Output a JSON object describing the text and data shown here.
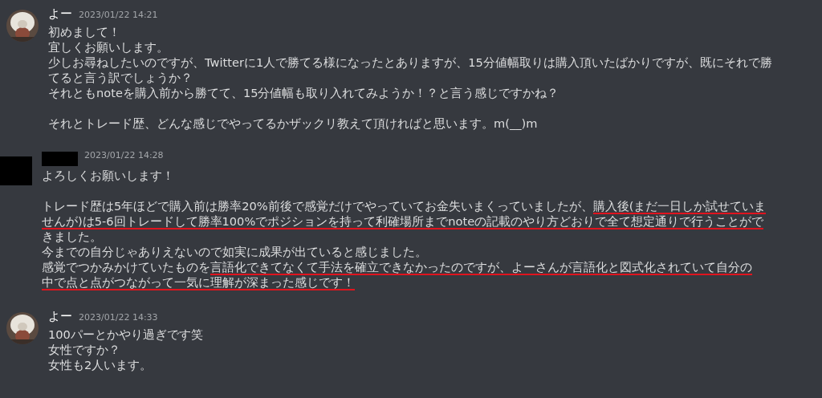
{
  "messages": [
    {
      "redacted": false,
      "author": "よー",
      "timestamp": "2023/01/22 14:21",
      "paragraphs": [
        {
          "lines": [
            [
              {
                "text": "初めまして！",
                "underlined": false
              }
            ],
            [
              {
                "text": "宜しくお願いします。",
                "underlined": false
              }
            ],
            [
              {
                "text": "少しお尋ねしたいのですが、Twitterに1人で勝てる様になったとありますが、15分値幅取りは購入頂いたばかりですが、既にそれで勝",
                "underlined": false
              }
            ],
            [
              {
                "text": "てると言う訳でしょうか？",
                "underlined": false
              }
            ],
            [
              {
                "text": "それともnoteを購入前から勝てて、15分値幅も取り入れてみようか！？と言う感じですかね？",
                "underlined": false
              }
            ]
          ]
        },
        {
          "lines": [
            [
              {
                "text": "それとトレード歴、どんな感じでやってるかザックリ教えて頂ければと思います。m(__)m",
                "underlined": false
              }
            ]
          ]
        }
      ]
    },
    {
      "redacted": true,
      "timestamp": "2023/01/22 14:28",
      "paragraphs": [
        {
          "lines": [
            [
              {
                "text": "よろしくお願いします！",
                "underlined": false
              }
            ]
          ]
        },
        {
          "lines": [
            [
              {
                "text": "トレード歴は5年ほどで購入前は勝率20%前後で感覚だけでやっていてお金失いまくっていましたが、",
                "underlined": false
              },
              {
                "text": "購入後(まだ一日しか試せていま",
                "underlined": true
              }
            ],
            [
              {
                "text": "せんが)は5-6回トレードして勝率100%でポジションを持って利確場所までnoteの記載のやり方どおりで全て想定通りで行うことがで",
                "underlined": true
              }
            ],
            [
              {
                "text": "きました。",
                "underlined": false
              }
            ],
            [
              {
                "text": "今までの自分じゃありえないので如実に成果が出ていると感じました。",
                "underlined": false
              }
            ],
            [
              {
                "text": "感覚でつかみかけていたものを",
                "underlined": false
              },
              {
                "text": "言語化できてなくて手法を確立できなかったのですが、よーさんが言語化と図式化されていて自分の",
                "underlined": true
              }
            ],
            [
              {
                "text": "中で点と点がつながって一気に理解が深まった感じです！",
                "underlined": true
              }
            ]
          ]
        }
      ]
    },
    {
      "redacted": false,
      "author": "よー",
      "timestamp": "2023/01/22 14:33",
      "paragraphs": [
        {
          "lines": [
            [
              {
                "text": "100パーとかやり過ぎです笑",
                "underlined": false
              }
            ],
            [
              {
                "text": "女性ですか？",
                "underlined": false
              }
            ],
            [
              {
                "text": "女性も2人います。",
                "underlined": false
              }
            ]
          ]
        }
      ]
    }
  ]
}
